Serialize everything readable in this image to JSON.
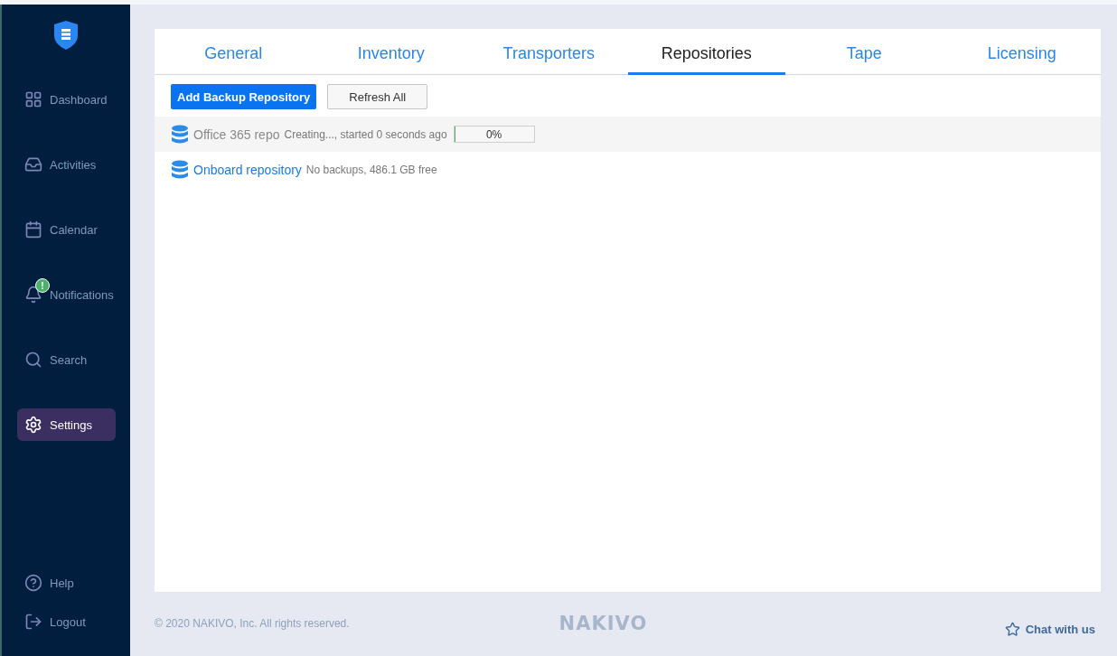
{
  "sidebar": {
    "items": [
      {
        "label": "Dashboard",
        "selected": false
      },
      {
        "label": "Activities",
        "selected": false
      },
      {
        "label": "Calendar",
        "selected": false
      },
      {
        "label": "Notifications",
        "selected": false,
        "alert": "!"
      },
      {
        "label": "Search",
        "selected": false
      },
      {
        "label": "Settings",
        "selected": true
      }
    ],
    "bottom_items": [
      {
        "label": "Help"
      },
      {
        "label": "Logout"
      }
    ]
  },
  "tabs": [
    {
      "label": "General",
      "selected": false
    },
    {
      "label": "Inventory",
      "selected": false
    },
    {
      "label": "Transporters",
      "selected": false
    },
    {
      "label": "Repositories",
      "selected": true
    },
    {
      "label": "Tape",
      "selected": false
    },
    {
      "label": "Licensing",
      "selected": false
    }
  ],
  "toolbar": {
    "primary": "Add Backup Repository",
    "secondary": "Refresh All"
  },
  "repositories": [
    {
      "name": "Office 365 repo",
      "status": "Creating..., started 0 seconds ago",
      "kind": "pending",
      "progress": {
        "level": 0,
        "label": "0%"
      }
    },
    {
      "name": "Onboard repository",
      "status": "No backups, 486.1 GB free",
      "kind": "ready"
    }
  ],
  "footer": {
    "copyright": "© 2020 NAKIVO, Inc. All rights reserved.",
    "brand": "NAKIVO",
    "chat": "Chat with us"
  }
}
